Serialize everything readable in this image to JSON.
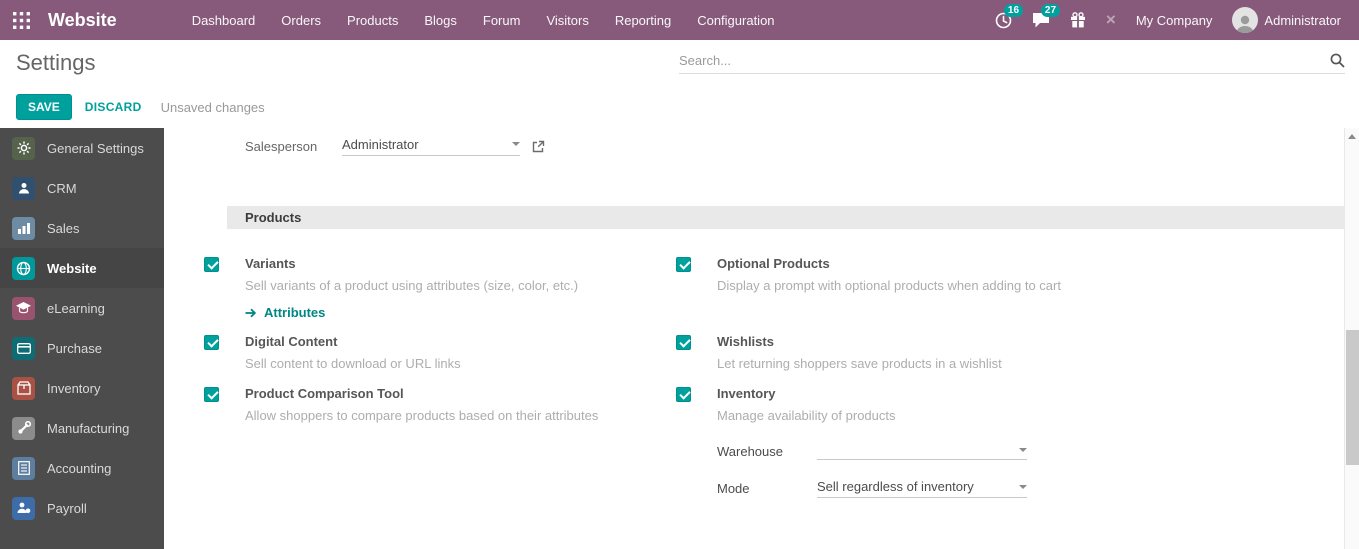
{
  "topbar": {
    "app_name": "Website",
    "menu": [
      "Dashboard",
      "Orders",
      "Products",
      "Blogs",
      "Forum",
      "Visitors",
      "Reporting",
      "Configuration"
    ],
    "activity_count": "16",
    "message_count": "27",
    "company": "My Company",
    "user_name": "Administrator"
  },
  "control_panel": {
    "title": "Settings",
    "search_placeholder": "Search...",
    "save": "SAVE",
    "discard": "DISCARD",
    "unsaved": "Unsaved changes"
  },
  "sidebar": {
    "items": [
      {
        "label": "General Settings"
      },
      {
        "label": "CRM"
      },
      {
        "label": "Sales"
      },
      {
        "label": "Website"
      },
      {
        "label": "eLearning"
      },
      {
        "label": "Purchase"
      },
      {
        "label": "Inventory"
      },
      {
        "label": "Manufacturing"
      },
      {
        "label": "Accounting"
      },
      {
        "label": "Payroll"
      }
    ],
    "active_item": "Website"
  },
  "main": {
    "salesperson": {
      "label": "Salesperson",
      "value": "Administrator"
    },
    "section_title": "Products",
    "settings": {
      "variants": {
        "title": "Variants",
        "desc": "Sell variants of a product using attributes (size, color, etc.)",
        "link": "Attributes",
        "checked": true
      },
      "optional_products": {
        "title": "Optional Products",
        "desc": "Display a prompt with optional products when adding to cart",
        "checked": true
      },
      "digital_content": {
        "title": "Digital Content",
        "desc": "Sell content to download or URL links",
        "checked": true
      },
      "wishlists": {
        "title": "Wishlists",
        "desc": "Let returning shoppers save products in a wishlist",
        "checked": true
      },
      "product_comparison": {
        "title": "Product Comparison Tool",
        "desc": "Allow shoppers to compare products based on their attributes",
        "checked": true
      },
      "inventory": {
        "title": "Inventory",
        "desc": "Manage availability of products",
        "checked": true,
        "warehouse": {
          "label": "Warehouse",
          "value": ""
        },
        "mode": {
          "label": "Mode",
          "value": "Sell regardless of inventory"
        }
      }
    }
  },
  "colors": {
    "accent": "#00A09D",
    "topbar": "#875A7B",
    "sidebar": "#4c4c4c"
  }
}
